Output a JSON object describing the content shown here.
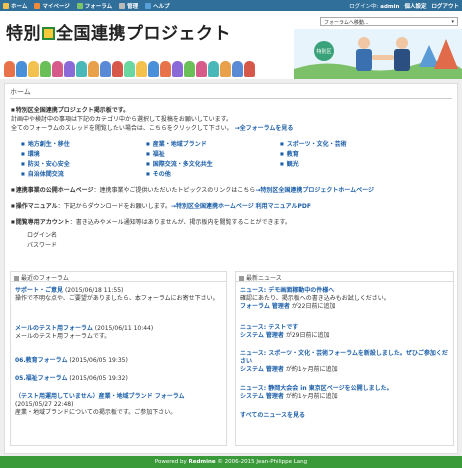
{
  "topbar": {
    "items": [
      "ホーム",
      "マイページ",
      "フォーラム",
      "管理",
      "ヘルプ"
    ],
    "login_prefix": "ログイン中:",
    "login_user": "admin",
    "personal": "個人設定",
    "logout": "ログアウト"
  },
  "header": {
    "title_a": "特別",
    "title_b": "全国連携プロジェクト",
    "forum_jump": "フォーラムへ移動...",
    "illust_badge": "特別区"
  },
  "breadcrumb": "ホーム",
  "intro": {
    "title": "特別区全国連携プロジェクト掲示板です。",
    "line1": "計画中や検討中の事項は下記のカテゴリ中から選択して投稿をお願いしています。",
    "line2": "全てのフォーラムのスレッドを閲覧したい場合は、こちらをクリックして下さい。",
    "all_link": "→全フォーラムを見る"
  },
  "categories": [
    [
      "地方創生・移住",
      "産業・地域ブランド",
      "スポーツ・文化・芸術"
    ],
    [
      "環境",
      "福祉",
      "教育"
    ],
    [
      "防災・安心安全",
      "国際交流・多文化共生",
      "観光"
    ],
    [
      "自治体間交流",
      "その他",
      ""
    ]
  ],
  "sections": {
    "homepage_title": "連携事業の公開ホームページ",
    "homepage_text": "：連携事業やご提供いただいたトピックスのリンクはこちら",
    "homepage_link": "→特別区全国連携プロジェクトホームページ",
    "manual_title": "操作マニュアル",
    "manual_text": "：下記からダウンロードをお願いします。",
    "manual_link1": "→特別区全国連携ホームページ",
    "manual_link2": "利用マニュアルPDF",
    "account_title": "閲覧専用アカウント",
    "account_text": "：書き込みやメール通知等はありませんが、掲示板内を閲覧することができます。",
    "login_name": "ログイン名",
    "password": "パスワード"
  },
  "recent_forums": {
    "header": "最近のフォーラム",
    "items": [
      {
        "title": "サポート・ご意見",
        "date": "(2015/06/18 11:55)",
        "desc": "操作で不明な点や、ご要望がありましたら、本フォーラムにお寄せ下さい。"
      },
      {
        "title": "メールのテスト用フォーラム",
        "date": "(2015/06/11 10:44)",
        "desc": "メールのテスト用フォーラムです。"
      },
      {
        "title": "06.教育フォーラム",
        "date": "(2015/06/05 19:35)",
        "desc": ""
      },
      {
        "title": "05.福祉フォーラム",
        "date": "(2015/06/05 19:32)",
        "desc": ""
      },
      {
        "title": "（テスト用運用していません）産業・地域ブランド フォーラム",
        "date": "(2015/05/27 22:48)",
        "desc": "産業・地域ブランドについての掲示板です。ご参加下さい。"
      }
    ]
  },
  "latest_news": {
    "header": "最新ニュース",
    "items": [
      {
        "title": "ニュース: デモ画面稼動中の件様へ",
        "desc": "確認にあたり、掲示板への書き込みもお試しください。",
        "author": "フォーラム 管理者",
        "ago": "が22日前に追加"
      },
      {
        "title": "ニュース: テストです",
        "desc": "",
        "author": "システム 管理者",
        "ago": "が29日前に追加"
      },
      {
        "title": "ニュース: スポーツ・文化・芸術フォーラムを新設しました。ぜひご参加ください",
        "desc": "",
        "author": "システム 管理者",
        "ago": "が約1ヶ月前に追加"
      },
      {
        "title": "ニュース: 静岡大会会 in 東京区ページを公開しました。",
        "desc": "",
        "author": "システム 管理者",
        "ago": "が約1ヶ月前に追加"
      }
    ],
    "all_link": "すべてのニュースを見る"
  },
  "footer": {
    "prefix": "Powered by",
    "brand": "Redmine",
    "suffix": "© 2006-2015 Jean-Philippe Lang"
  },
  "colors": {
    "topbar": "#2f6f9a",
    "link": "#1c5fa8",
    "footer": "#3a9a3a"
  }
}
